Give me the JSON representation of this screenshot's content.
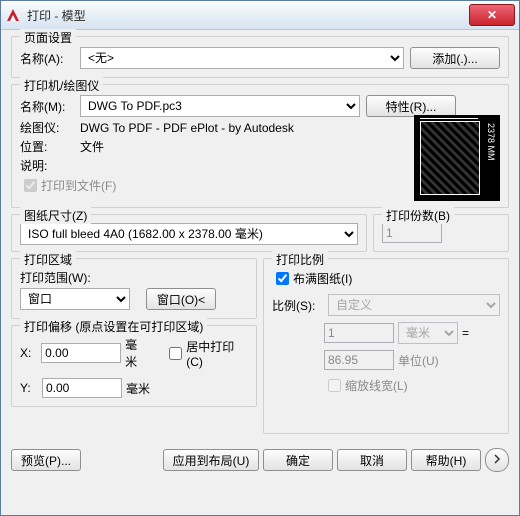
{
  "window": {
    "title": "打印 - 模型",
    "close": "✕"
  },
  "page_setup": {
    "legend": "页面设置",
    "name_label": "名称(A):",
    "name_value": "<无>",
    "add_btn": "添加(.)..."
  },
  "printer": {
    "legend": "打印机/绘图仪",
    "name_label": "名称(M):",
    "name_value": "DWG To PDF.pc3",
    "props_btn": "特性(R)...",
    "plotter_label": "绘图仪:",
    "plotter_value": "DWG To PDF - PDF ePlot - by Autodesk",
    "location_label": "位置:",
    "location_value": "文件",
    "desc_label": "说明:",
    "desc_value": "",
    "tofile_label": "打印到文件(F)",
    "preview_dim": "2378 MM"
  },
  "paper": {
    "legend": "图纸尺寸(Z)",
    "value": "ISO full bleed 4A0 (1682.00 x 2378.00 毫米)"
  },
  "copies": {
    "legend": "打印份数(B)",
    "value": "1"
  },
  "area": {
    "legend": "打印区域",
    "range_label": "打印范围(W):",
    "range_value": "窗口",
    "window_btn": "窗口(O)<"
  },
  "scale": {
    "legend": "打印比例",
    "fit_label": "布满图纸(I)",
    "scale_label": "比例(S):",
    "scale_value": "自定义",
    "num": "1",
    "unit": "毫米",
    "eq": "=",
    "den": "86.95",
    "unit2": "单位(U)",
    "lw_label": "缩放线宽(L)"
  },
  "offset": {
    "legend": "打印偏移 (原点设置在可打印区域)",
    "x_label": "X:",
    "x_value": "0.00",
    "y_label": "Y:",
    "y_value": "0.00",
    "unit": "毫米",
    "center_label": "居中打印(C)"
  },
  "footer": {
    "preview": "预览(P)...",
    "apply": "应用到布局(U)",
    "ok": "确定",
    "cancel": "取消",
    "help": "帮助(H)"
  },
  "colors": {
    "accent": "#c8232c"
  }
}
